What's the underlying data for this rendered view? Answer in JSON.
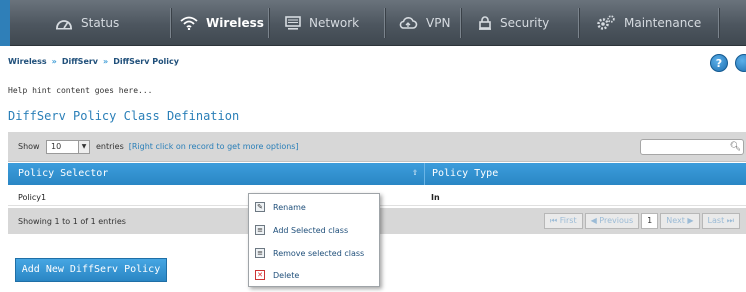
{
  "nav": {
    "items": [
      {
        "label": "Status",
        "icon": "dashboard-icon"
      },
      {
        "label": "Wireless",
        "icon": "wifi-icon"
      },
      {
        "label": "Network",
        "icon": "monitor-icon"
      },
      {
        "label": "VPN",
        "icon": "cloud-icon"
      },
      {
        "label": "Security",
        "icon": "lock-icon"
      },
      {
        "label": "Maintenance",
        "icon": "gears-icon"
      }
    ],
    "active": "Wireless"
  },
  "breadcrumb": {
    "items": [
      "Wireless",
      "DiffServ",
      "DiffServ Policy"
    ],
    "separator": "»"
  },
  "help": {
    "symbol": "?"
  },
  "hint": "Help hint content goes here...",
  "page_title": "DiffServ Policy Class Defination",
  "table": {
    "show_label": "Show",
    "show_value": "10",
    "entries_label": "entries",
    "context_hint": "[Right click on record to get more options]",
    "columns": [
      "Policy Selector",
      "Policy Type"
    ],
    "rows": [
      {
        "selector": "Policy1",
        "type": "In"
      }
    ],
    "info": "Showing 1 to 1 of 1 entries",
    "pager": {
      "first": "First",
      "previous": "Previous",
      "page": "1",
      "next": "Next",
      "last": "Last"
    }
  },
  "add_button": "Add New DiffServ Policy",
  "context_menu": {
    "items": [
      {
        "label": "Rename",
        "icon": "pencil-icon"
      },
      {
        "label": "Add Selected class",
        "icon": "list-icon"
      },
      {
        "label": "Remove selected class",
        "icon": "list-icon"
      },
      {
        "label": "Delete",
        "icon": "delete-x-icon"
      }
    ]
  },
  "colors": {
    "accent": "#2a86c4",
    "nav_bg": "#4d565f",
    "delete": "#d22222"
  }
}
